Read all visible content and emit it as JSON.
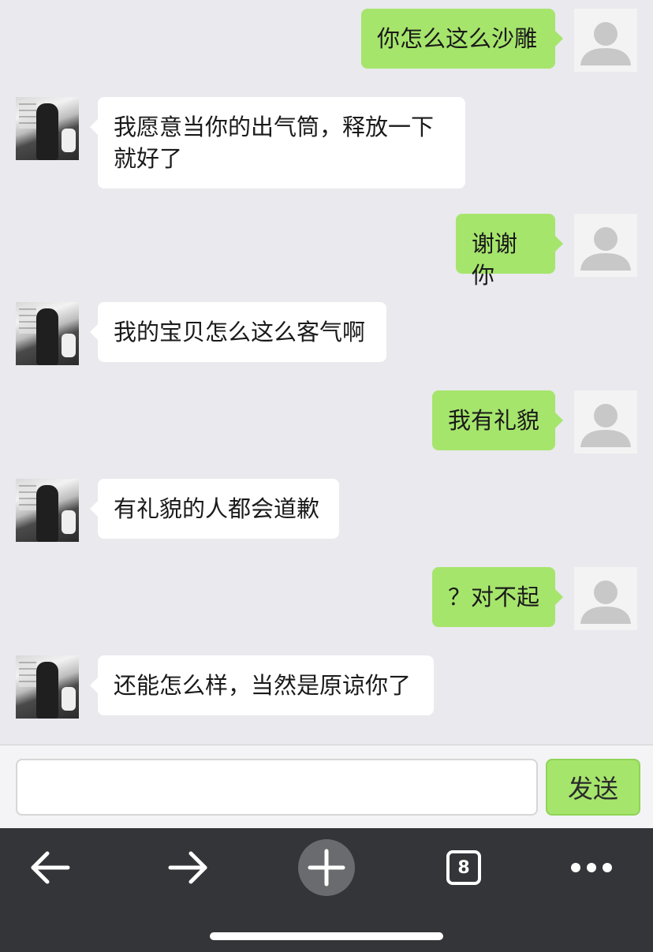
{
  "chat": {
    "messages": [
      {
        "side": "right",
        "text": "你怎么这么沙雕"
      },
      {
        "side": "left",
        "text": "我愿意当你的出气筒，释放一下就好了"
      },
      {
        "side": "right",
        "text": "谢谢你"
      },
      {
        "side": "left",
        "text": "我的宝贝怎么这么客气啊"
      },
      {
        "side": "right",
        "text": "我有礼貌"
      },
      {
        "side": "left",
        "text": "有礼貌的人都会道歉"
      },
      {
        "side": "right",
        "text": "？对不起"
      },
      {
        "side": "left",
        "text": "还能怎么样，当然是原谅你了"
      }
    ]
  },
  "input": {
    "value": "",
    "placeholder": "",
    "send_label": "发送"
  },
  "toolbar": {
    "back_icon": "arrow-left-icon",
    "forward_icon": "arrow-right-icon",
    "new_tab_icon": "plus-icon",
    "tabs_count": "8",
    "more_icon": "ellipsis-icon"
  },
  "colors": {
    "background": "#e9e9ee",
    "bubble_me": "#a6e56c",
    "bubble_other": "#ffffff",
    "toolbar": "#343538"
  }
}
